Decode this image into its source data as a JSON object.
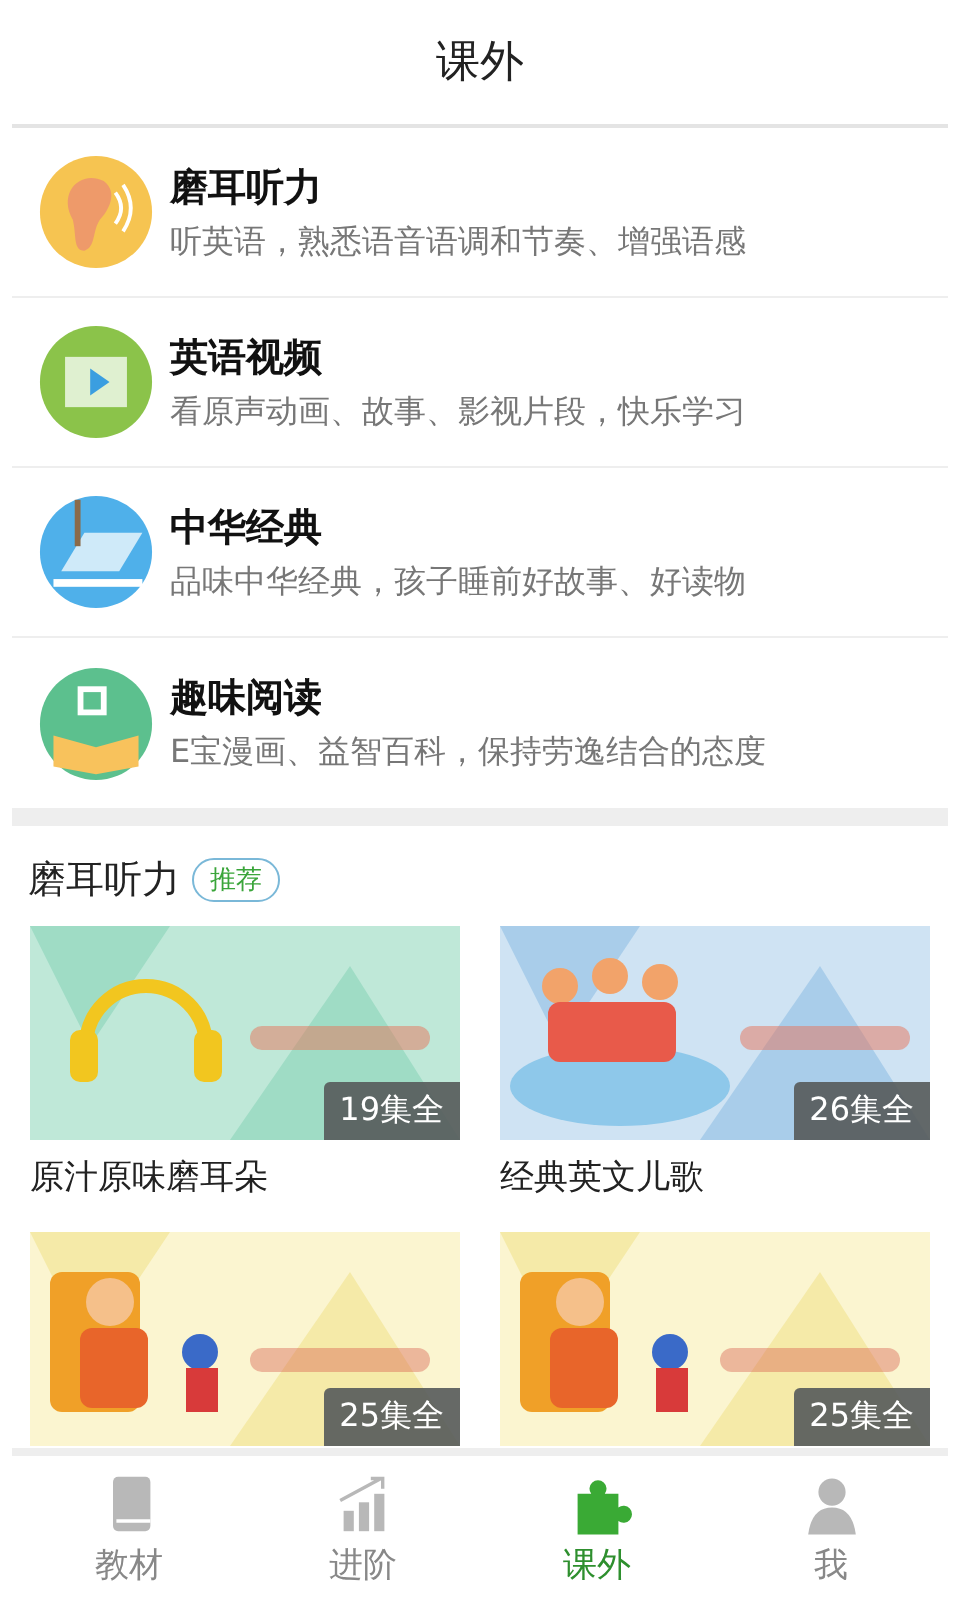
{
  "header": {
    "title": "课外"
  },
  "categories": [
    {
      "kind": "ear",
      "title": "磨耳听力",
      "subtitle": "听英语，熟悉语音语调和节奏、增强语感"
    },
    {
      "kind": "video",
      "title": "英语视频",
      "subtitle": "看原声动画、故事、影视片段，快乐学习"
    },
    {
      "kind": "classic",
      "title": "中华经典",
      "subtitle": "品味中华经典，孩子睡前好故事、好读物"
    },
    {
      "kind": "reading",
      "title": "趣味阅读",
      "subtitle": "E宝漫画、益智百科，保持劳逸结合的态度"
    }
  ],
  "section": {
    "title": "磨耳听力",
    "badge": "推荐"
  },
  "albums": [
    {
      "kind": "picture",
      "count": "19集全",
      "title": "原汁原味磨耳朵"
    },
    {
      "kind": "picture",
      "count": "26集全",
      "title": "经典英文儿歌"
    },
    {
      "kind": "picture",
      "count": "25集全"
    },
    {
      "kind": "picture",
      "count": "25集全"
    }
  ],
  "tabs": [
    {
      "kind": "book",
      "label": "教材",
      "selected": false
    },
    {
      "kind": "chart",
      "label": "进阶",
      "selected": false
    },
    {
      "kind": "puzzle",
      "label": "课外",
      "selected": true
    },
    {
      "kind": "person",
      "label": "我",
      "selected": false
    }
  ]
}
